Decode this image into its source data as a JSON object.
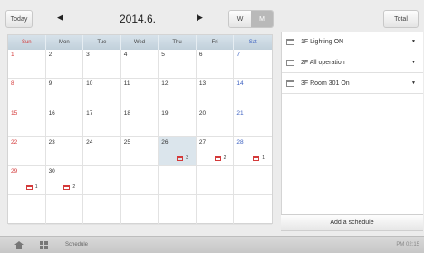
{
  "toolbar": {
    "today_label": "Today",
    "month_title": "2014.6.",
    "view_week_label": "W",
    "view_month_label": "M",
    "total_label": "Total"
  },
  "calendar": {
    "weekdays": [
      "Sun",
      "Mon",
      "Tue",
      "Wed",
      "Thu",
      "Fri",
      "Sat"
    ],
    "weeks": [
      [
        "1",
        "2",
        "3",
        "4",
        "5",
        "6",
        "7"
      ],
      [
        "8",
        "9",
        "10",
        "11",
        "12",
        "13",
        "14"
      ],
      [
        "15",
        "16",
        "17",
        "18",
        "19",
        "20",
        "21"
      ],
      [
        "22",
        "23",
        "24",
        "25",
        "26",
        "27",
        "28"
      ],
      [
        "29",
        "30",
        "",
        "",
        "",
        "",
        ""
      ],
      [
        "",
        "",
        "",
        "",
        "",
        "",
        ""
      ]
    ],
    "highlight_day": "26",
    "badges": [
      {
        "day": "26",
        "count": "3"
      },
      {
        "day": "27",
        "count": "2"
      },
      {
        "day": "28",
        "count": "1"
      },
      {
        "day": "29",
        "count": "1"
      },
      {
        "day": "30",
        "count": "2"
      }
    ]
  },
  "schedules": [
    {
      "label": "1F Lighting ON"
    },
    {
      "label": "2F All operation"
    },
    {
      "label": "3F Room 301 On"
    }
  ],
  "add_schedule_label": "Add a schedule",
  "bottom": {
    "screen_label": "Schedule",
    "clock": "PM 02:15"
  },
  "colors": {
    "sunday": "#d43a3a",
    "saturday": "#3a5fc0",
    "highlight": "#dbe5ec",
    "badge": "#d43a3a"
  }
}
